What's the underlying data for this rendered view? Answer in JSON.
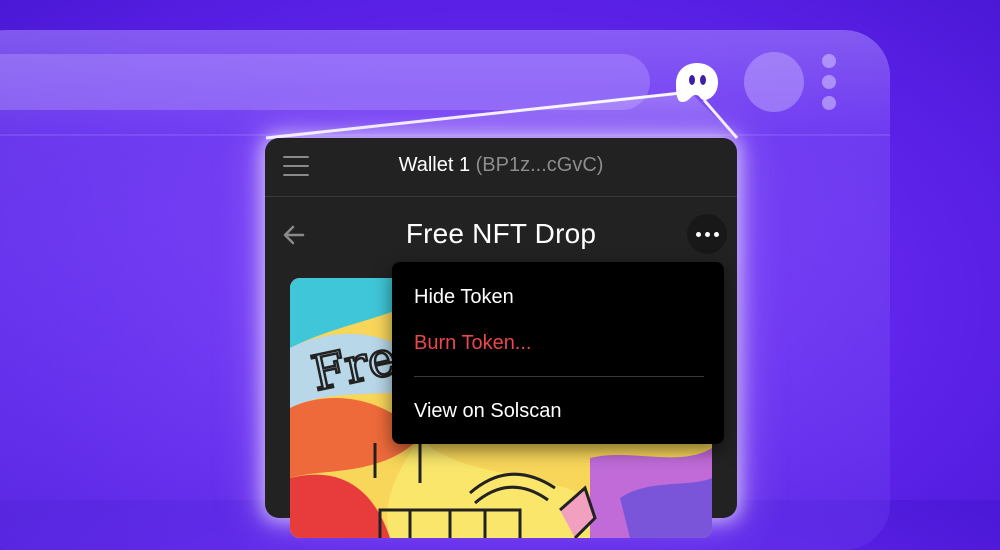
{
  "wallet": {
    "name": "Wallet 1",
    "address_short": "(BP1z...cGvC)"
  },
  "token_page": {
    "title": "Free NFT Drop"
  },
  "nft": {
    "art_text": "Fre"
  },
  "context_menu": {
    "items": [
      {
        "label": "Hide Token",
        "style": "normal"
      },
      {
        "label": "Burn Token...",
        "style": "danger"
      },
      {
        "label": "View on Solscan",
        "style": "normal"
      }
    ]
  },
  "colors": {
    "danger": "#e9474c",
    "background_purple": "#6a2cf0",
    "panel": "#222222"
  },
  "icons": [
    "hamburger-menu-icon",
    "back-arrow-icon",
    "more-options-icon",
    "phantom-ghost-icon",
    "profile-avatar-icon",
    "browser-kebab-icon"
  ]
}
